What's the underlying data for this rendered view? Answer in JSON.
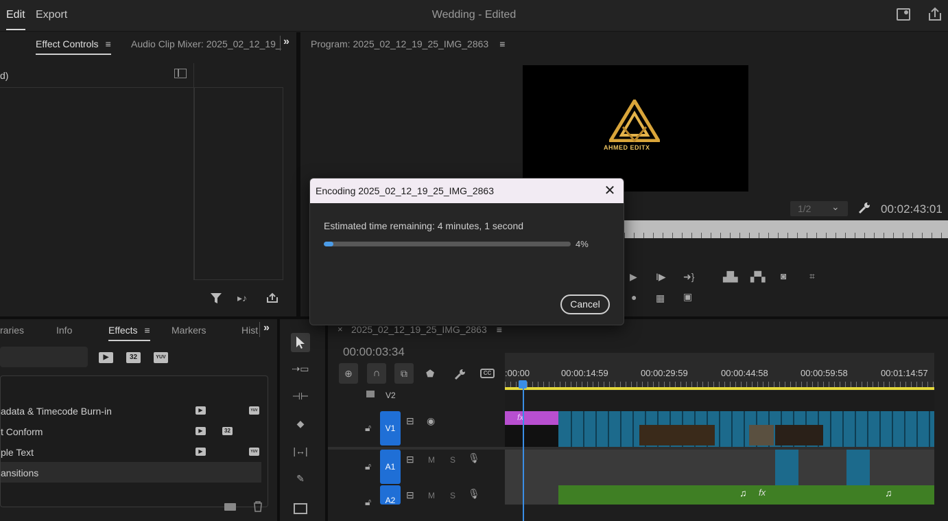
{
  "menu": {
    "edit": "Edit",
    "export": "Export"
  },
  "app_title": "Wedding - Edited",
  "source_panel": {
    "tabs": [
      "Effect Controls",
      "Audio Clip Mixer: 2025_02_12_19_"
    ],
    "more": "»",
    "header_text": "d)"
  },
  "program": {
    "title": "Program: 2025_02_12_19_25_IMG_2863",
    "logo_text": "AHMED EDITX",
    "resolution": "1/2",
    "timecode": "00:02:43:01"
  },
  "effects_panel": {
    "tabs": [
      "raries",
      "Info",
      "Effects",
      "Markers",
      "Hist"
    ],
    "badges": [
      "32",
      "YUV"
    ],
    "items": [
      {
        "label": "adata & Timecode Burn-in",
        "b2": "",
        "b3": "YUV"
      },
      {
        "label": "t Conform",
        "b2": "32",
        "b3": ""
      },
      {
        "label": "ple Text",
        "b2": "",
        "b3": "YUV"
      },
      {
        "label": "ansitions",
        "b2": "",
        "b3": ""
      }
    ]
  },
  "timeline": {
    "sequence": "2025_02_12_19_25_IMG_2863",
    "close": "×",
    "timecode": "00:00:03:34",
    "ruler": [
      ":00:00",
      "00:00:14:59",
      "00:00:29:59",
      "00:00:44:58",
      "00:00:59:58",
      "00:01:14:57"
    ],
    "tracks": [
      "V2",
      "V1",
      "A1",
      "A2"
    ],
    "m": "M",
    "s": "S",
    "fx": "fx"
  },
  "dialog": {
    "title": "Encoding 2025_02_12_19_25_IMG_2863",
    "estimate": "Estimated time remaining: 4 minutes, 1 second",
    "progress": 4,
    "percent_label": "4%",
    "cancel": "Cancel"
  },
  "colors": {
    "accent": "#4b9ce8",
    "track_blue": "#1f6fd6",
    "clip_blue": "#1c6a8c",
    "clip_pink": "#b84fd0",
    "audio_green": "#3f7f24",
    "playhead": "#3a8ee6"
  }
}
